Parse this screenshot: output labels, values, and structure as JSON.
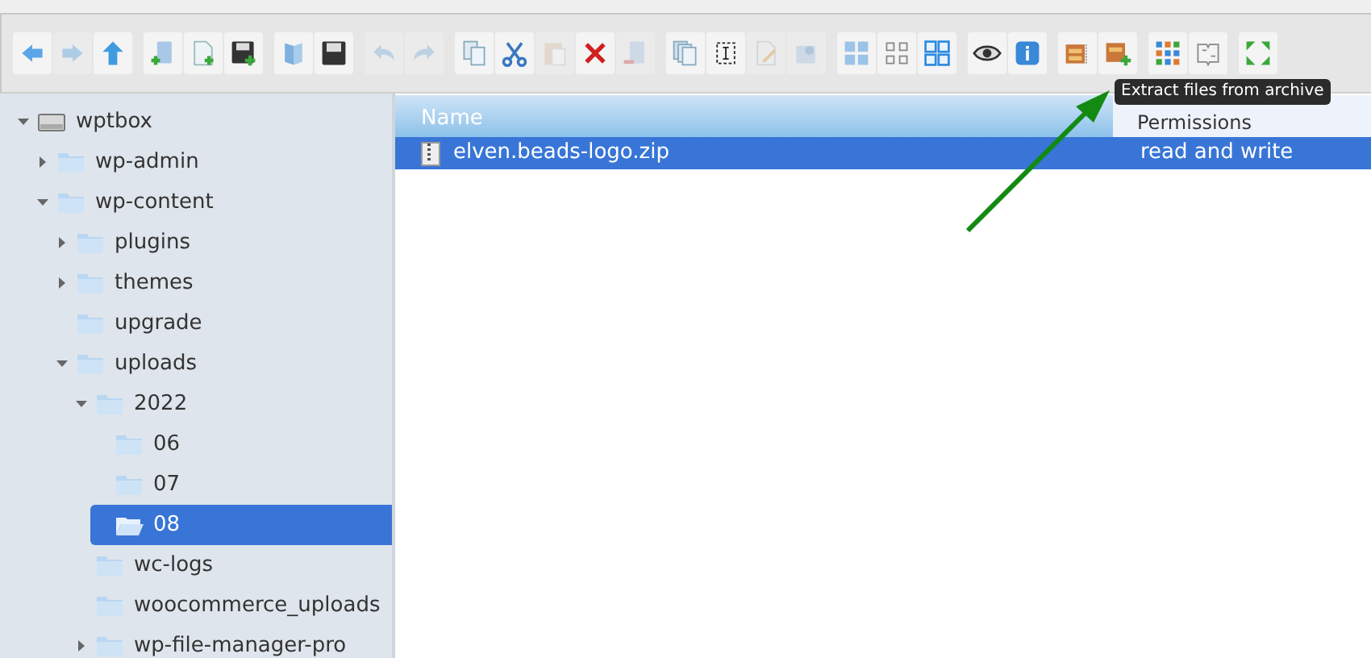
{
  "toolbar": [
    [
      {
        "kind": "back",
        "disabled": false
      },
      {
        "kind": "forward",
        "disabled": true
      },
      {
        "kind": "up",
        "disabled": false
      }
    ],
    [
      {
        "kind": "new-folder",
        "disabled": false
      },
      {
        "kind": "new-file",
        "disabled": false
      },
      {
        "kind": "save-new",
        "disabled": false
      }
    ],
    [
      {
        "kind": "open",
        "disabled": false
      },
      {
        "kind": "save",
        "disabled": false
      }
    ],
    [
      {
        "kind": "undo",
        "disabled": true
      },
      {
        "kind": "redo",
        "disabled": true
      }
    ],
    [
      {
        "kind": "copy",
        "disabled": false
      },
      {
        "kind": "cut",
        "disabled": false
      },
      {
        "kind": "paste",
        "disabled": true
      },
      {
        "kind": "delete",
        "disabled": false
      },
      {
        "kind": "remove",
        "disabled": true
      }
    ],
    [
      {
        "kind": "duplicate",
        "disabled": false
      },
      {
        "kind": "select",
        "disabled": false
      },
      {
        "kind": "rename",
        "disabled": true
      },
      {
        "kind": "resize",
        "disabled": true
      }
    ],
    [
      {
        "kind": "view-icons",
        "disabled": false
      },
      {
        "kind": "view-small",
        "disabled": false
      },
      {
        "kind": "view-list",
        "disabled": false
      }
    ],
    [
      {
        "kind": "preview",
        "disabled": false
      },
      {
        "kind": "info",
        "disabled": false
      }
    ],
    [
      {
        "kind": "extract",
        "disabled": false
      },
      {
        "kind": "archive",
        "disabled": false
      }
    ],
    [
      {
        "kind": "grid",
        "disabled": false
      },
      {
        "kind": "sort",
        "disabled": false
      }
    ],
    [
      {
        "kind": "fullscreen",
        "disabled": false
      }
    ]
  ],
  "tooltip": "Extract files from archive",
  "tree": [
    {
      "label": "wptbox",
      "kind": "drive",
      "expanded": true,
      "selected": false,
      "children": [
        {
          "label": "wp-admin",
          "expanded": false,
          "selected": false,
          "has_children": true
        },
        {
          "label": "wp-content",
          "expanded": true,
          "selected": false,
          "children": [
            {
              "label": "plugins",
              "expanded": false,
              "selected": false,
              "has_children": true
            },
            {
              "label": "themes",
              "expanded": false,
              "selected": false,
              "has_children": true
            },
            {
              "label": "upgrade",
              "selected": false
            },
            {
              "label": "uploads",
              "expanded": true,
              "selected": false,
              "children": [
                {
                  "label": "2022",
                  "expanded": true,
                  "selected": false,
                  "children": [
                    {
                      "label": "06",
                      "selected": false
                    },
                    {
                      "label": "07",
                      "selected": false
                    },
                    {
                      "label": "08",
                      "selected": true
                    }
                  ]
                },
                {
                  "label": "wc-logs",
                  "selected": false
                },
                {
                  "label": "woocommerce_uploads",
                  "selected": false
                },
                {
                  "label": "wp-file-manager-pro",
                  "expanded": false,
                  "selected": false,
                  "has_children": true
                }
              ]
            }
          ]
        }
      ]
    }
  ],
  "table": {
    "columns": [
      "Name",
      "Permissions"
    ],
    "rows": [
      {
        "name": "elven.beads-logo.zip",
        "permissions": "read and write",
        "selected": true
      }
    ]
  }
}
